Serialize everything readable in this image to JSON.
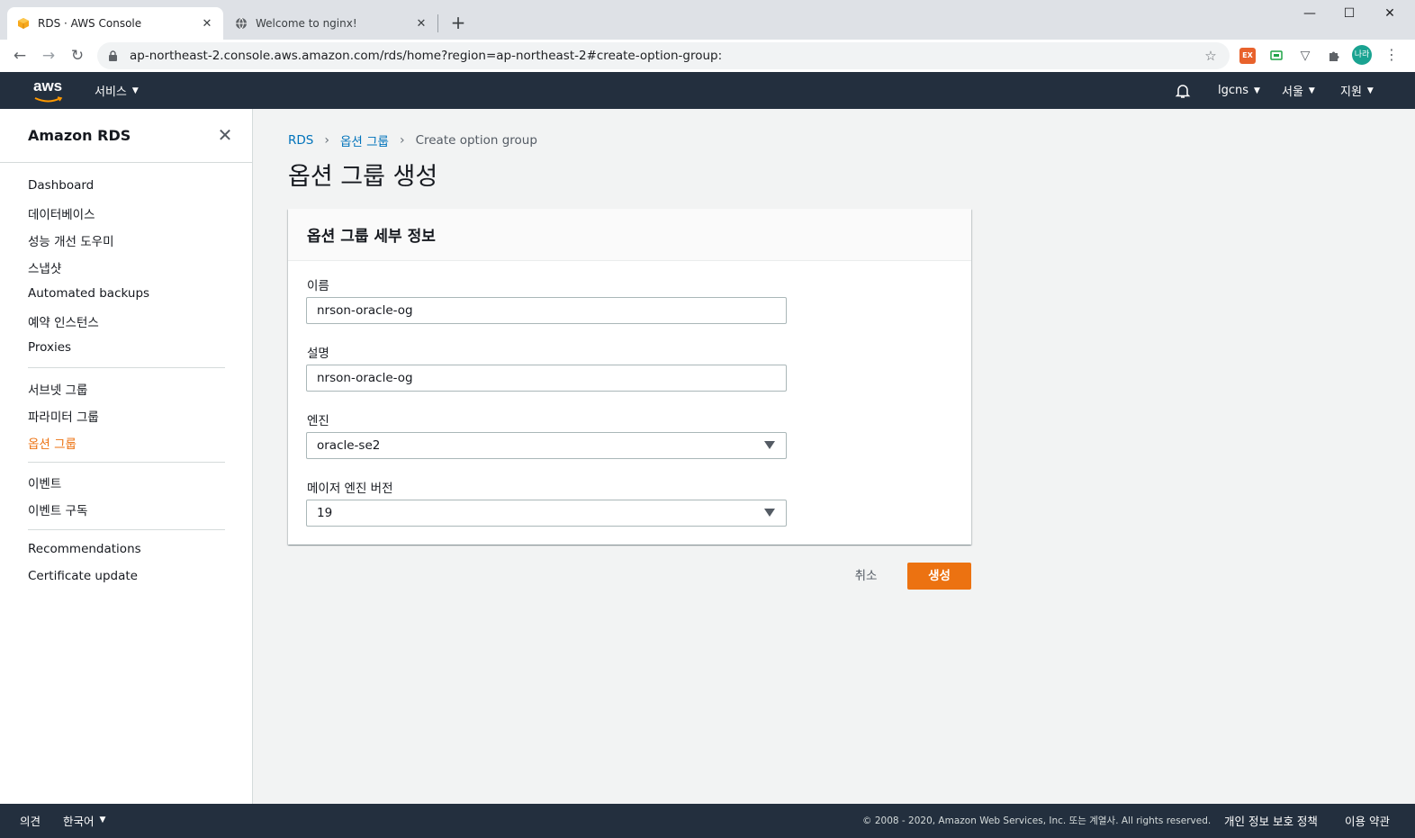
{
  "browser": {
    "tabs": [
      {
        "title": "RDS · AWS Console",
        "active": true
      },
      {
        "title": "Welcome to nginx!",
        "active": false
      }
    ],
    "url": "ap-northeast-2.console.aws.amazon.com/rds/home?region=ap-northeast-2#create-option-group:",
    "profile_initials": "나라",
    "ext_label": "EX"
  },
  "aws_header": {
    "logo_text": "aws",
    "services_label": "서비스",
    "account_label": "lgcns",
    "region_label": "서울",
    "support_label": "지원"
  },
  "sidebar": {
    "title": "Amazon RDS",
    "group1": [
      {
        "label": "Dashboard"
      },
      {
        "label": "데이터베이스"
      },
      {
        "label": "성능 개선 도우미"
      },
      {
        "label": "스냅샷"
      },
      {
        "label": "Automated backups"
      },
      {
        "label": "예약 인스턴스"
      },
      {
        "label": "Proxies"
      }
    ],
    "group2": [
      {
        "label": "서브넷 그룹"
      },
      {
        "label": "파라미터 그룹"
      },
      {
        "label": "옵션 그룹",
        "active": true
      }
    ],
    "group3": [
      {
        "label": "이벤트"
      },
      {
        "label": "이벤트 구독"
      }
    ],
    "group4": [
      {
        "label": "Recommendations"
      },
      {
        "label": "Certificate update"
      }
    ]
  },
  "breadcrumb": {
    "items": [
      "RDS",
      "옵션 그룹",
      "Create option group"
    ]
  },
  "page": {
    "title": "옵션 그룹 생성"
  },
  "panel": {
    "title": "옵션 그룹 세부 정보",
    "fields": {
      "name": {
        "label": "이름",
        "value": "nrson-oracle-og"
      },
      "description": {
        "label": "설명",
        "value": "nrson-oracle-og"
      },
      "engine": {
        "label": "엔진",
        "value": "oracle-se2"
      },
      "major_version": {
        "label": "메이저 엔진 버전",
        "value": "19"
      }
    }
  },
  "actions": {
    "cancel_label": "취소",
    "create_label": "생성"
  },
  "footer": {
    "feedback_label": "의견",
    "language_label": "한국어",
    "copyright": "© 2008 - 2020, Amazon Web Services, Inc. 또는 계열사. All rights reserved.",
    "privacy_label": "개인 정보 보호 정책",
    "terms_label": "이용 약관"
  },
  "colors": {
    "aws_nav_bg": "#232f3e",
    "accent_orange": "#ec7211",
    "link_blue": "#0073bb",
    "page_bg": "#f2f3f3"
  }
}
